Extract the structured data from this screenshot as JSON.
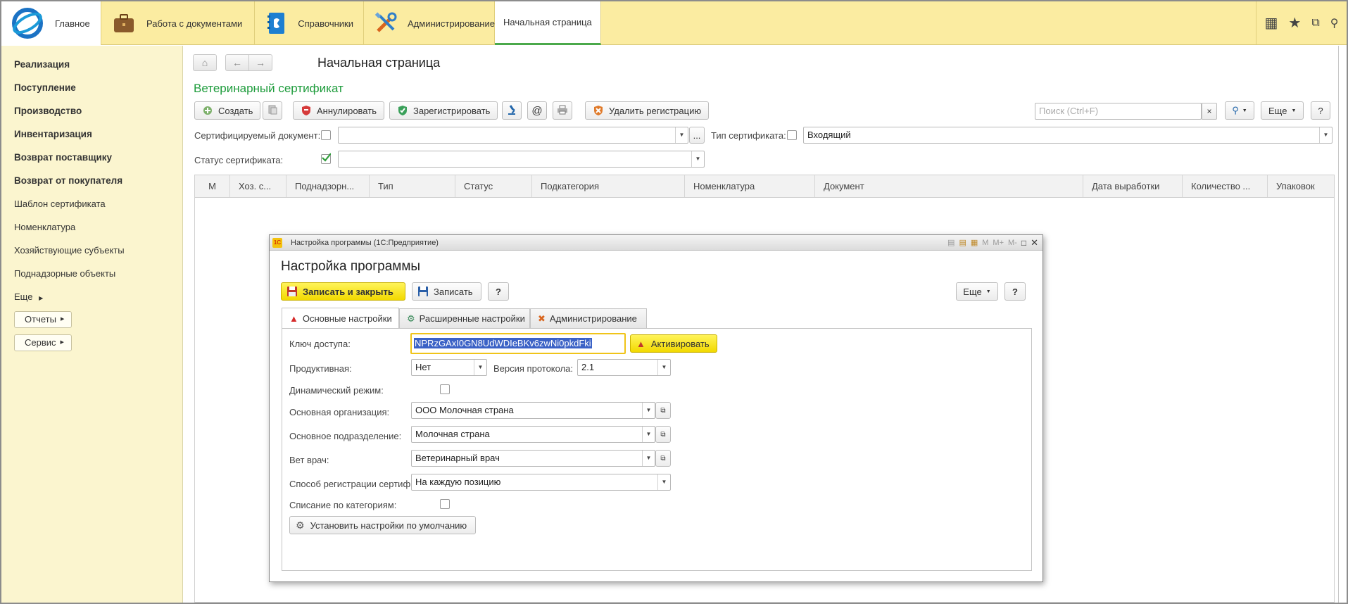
{
  "topbar": {
    "home_label": "Главное",
    "sections": [
      {
        "label": "Работа с документами",
        "icon": "briefcase-icon"
      },
      {
        "label": "Справочники",
        "icon": "address-book-icon"
      },
      {
        "label": "Администрирование",
        "icon": "tools-icon"
      }
    ],
    "active_tab": "Начальная страница",
    "right_icons": [
      "apps-grid-icon",
      "star-icon",
      "history-icon",
      "search-icon"
    ]
  },
  "sidebar": {
    "bold_items": [
      "Реализация",
      "Поступление",
      "Производство",
      "Инвентаризация",
      "Возврат поставщику",
      "Возврат от покупателя"
    ],
    "items": [
      "Шаблон сертификата",
      "Номенклатура",
      "Хозяйствующие субъекты",
      "Поднадзорные объекты"
    ],
    "more_label": "Еще",
    "buttons": [
      "Отчеты",
      "Сервис"
    ]
  },
  "main": {
    "page_title": "Начальная страница",
    "form_title": "Ветеринарный сертификат",
    "toolbar": {
      "create": "Создать",
      "annul": "Аннулировать",
      "register": "Зарегистрировать",
      "email_symbol": "@",
      "delete_registration": "Удалить регистрацию",
      "search_placeholder": "Поиск (Ctrl+F)",
      "clear_symbol": "×",
      "more": "Еще",
      "help": "?"
    },
    "filters": {
      "certified_doc_label": "Сертифицируемый документ:",
      "certified_doc_value": "",
      "cert_type_label": "Тип сертификата:",
      "cert_type_value": "Входящий",
      "cert_status_label": "Статус сертификата:",
      "cert_status_value": "",
      "cert_status_checked": true,
      "ellipsis": "..."
    },
    "columns": [
      "М",
      "Хоз. с...",
      "Поднадзорн...",
      "Тип",
      "Статус",
      "Подкатегория",
      "Номенклатура",
      "Документ",
      "Дата выработки",
      "Количество ...",
      "Упаковок"
    ]
  },
  "modal": {
    "window_title": "Настройка программы  (1С:Предприятие)",
    "title": "Настройка программы",
    "title_ctrls": [
      "M",
      "M+",
      "M-"
    ],
    "save_close": "Записать и закрыть",
    "save": "Записать",
    "help": "?",
    "more": "Еще",
    "tabs": [
      "Основные настройки",
      "Расширенные настройки",
      "Администрирование"
    ],
    "fields": {
      "access_key_label": "Ключ доступа:",
      "access_key_value": "NPRzGAxI0GN8UdWDIeBKv6zwNi0pkdFki",
      "activate": "Активировать",
      "productive_label": "Продуктивная:",
      "productive_value": "Нет",
      "protocol_label": "Версия протокола:",
      "protocol_value": "2.1",
      "dynamic_label": "Динамический режим:",
      "org_label": "Основная организация:",
      "org_value": "ООО Молочная страна",
      "division_label": "Основное подразделение:",
      "division_value": "Молочная страна",
      "vet_label": "Вет врач:",
      "vet_value": "Ветеринарный врач",
      "reg_method_label": "Способ регистрации сертификатов:",
      "reg_method_value": "На каждую позицию",
      "writeoff_label": "Списание по категориям:",
      "default_settings": "Установить настройки по умолчанию"
    }
  },
  "colors": {
    "topbar": "#fbeca1",
    "sidebar": "#fbf5cf",
    "accent_green": "#1e9c3c",
    "yellow_button": "#f7e31d"
  }
}
